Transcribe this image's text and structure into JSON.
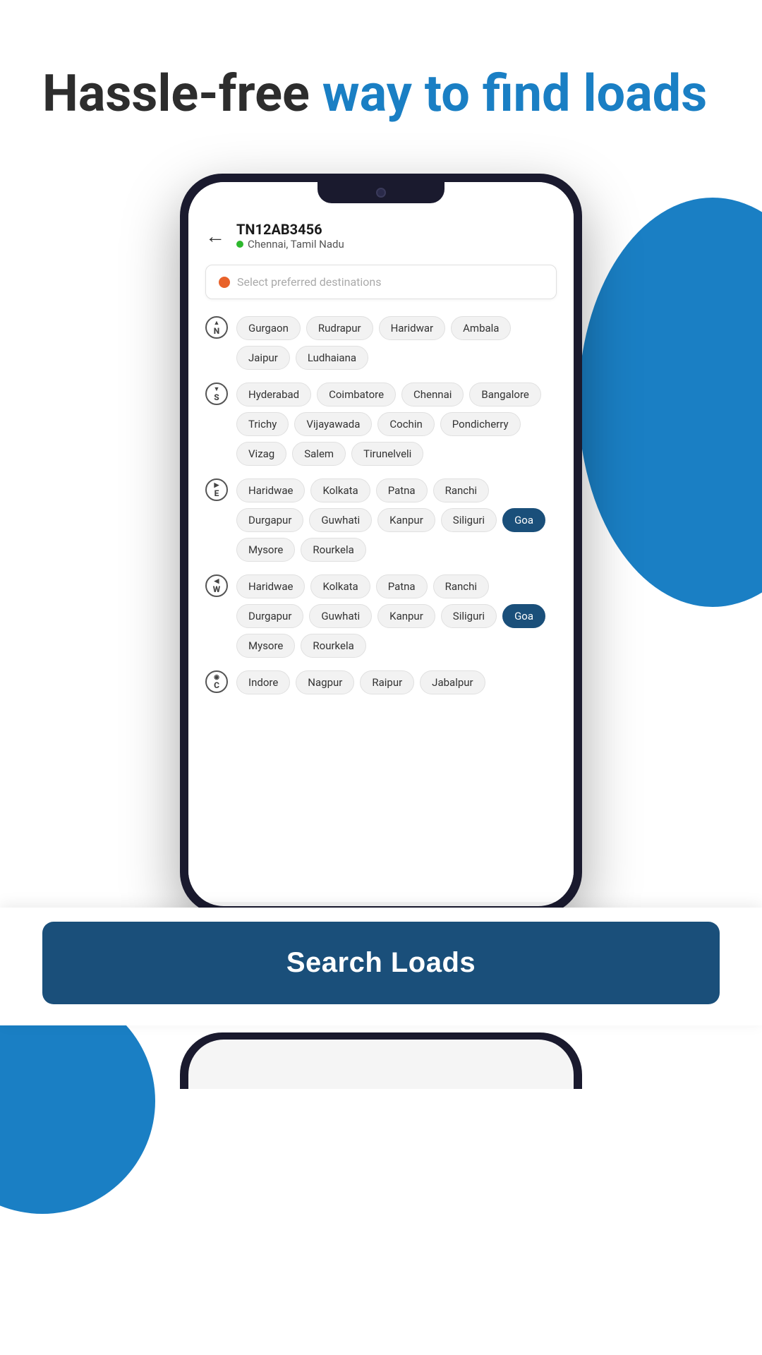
{
  "hero": {
    "title_plain": "Hassle-free ",
    "title_blue": "way to find loads"
  },
  "phone": {
    "vehicle_id": "TN12AB3456",
    "vehicle_location": "Chennai, Tamil Nadu",
    "search_placeholder": "Select preferred destinations",
    "back_label": "←",
    "directions": [
      {
        "id": "north",
        "badge_top": "▲",
        "badge_letter": "N",
        "tags": [
          "Gurgaon",
          "Rudrapur",
          "Haridwar",
          "Ambala",
          "Jaipur",
          "Ludhaiana"
        ]
      },
      {
        "id": "south",
        "badge_top": "▼",
        "badge_letter": "S",
        "tags": [
          "Hyderabad",
          "Coimbatore",
          "Chennai",
          "Bangalore",
          "Trichy",
          "Vijayawada",
          "Cochin",
          "Pondicherry",
          "Vizag",
          "Salem",
          "Tirunelveli"
        ]
      },
      {
        "id": "east",
        "badge_top": "▶",
        "badge_letter": "E",
        "tags": [
          "Haridwae",
          "Kolkata",
          "Patna",
          "Ranchi",
          "Durgapur",
          "Guwhati",
          "Kanpur",
          "Siliguri",
          "Goa",
          "Mysore",
          "Rourkela"
        ]
      },
      {
        "id": "west",
        "badge_top": "◀",
        "badge_letter": "W",
        "tags": [
          "Haridwae",
          "Kolkata",
          "Patna",
          "Ranchi",
          "Durgapur",
          "Guwhati",
          "Kanpur",
          "Siliguri",
          "Goa",
          "Mysore",
          "Rourkela"
        ]
      },
      {
        "id": "central",
        "badge_top": "◉",
        "badge_letter": "C",
        "tags": [
          "Indore",
          "Nagpur",
          "Raipur",
          "Jabalpur"
        ]
      }
    ],
    "selected_tags": [
      "Goa"
    ]
  },
  "bottom_bar": {
    "search_button_label": "Search Loads"
  }
}
